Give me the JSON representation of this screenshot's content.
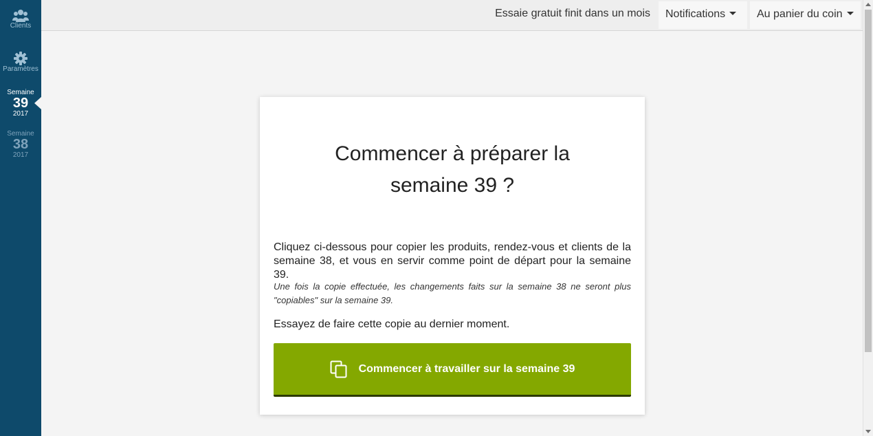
{
  "sidebar": {
    "clients": {
      "label": "Clients",
      "icon": "users-icon"
    },
    "params": {
      "label": "Paramètres",
      "icon": "gear-icon"
    },
    "weeks": [
      {
        "label": "Semaine",
        "number": "39",
        "year": "2017",
        "active": true
      },
      {
        "label": "Semaine",
        "number": "38",
        "year": "2017",
        "active": false
      }
    ]
  },
  "topbar": {
    "trial_text": "Essaie gratuit finit dans un mois",
    "notifications_label": "Notifications",
    "shop_label": "Au panier du coin"
  },
  "card": {
    "title_line1": "Commencer à préparer la",
    "title_line2": "semaine 39 ?",
    "main_text": "Cliquez ci-dessous pour copier les produits, rendez-vous et clients de la semaine 38, et vous en servir comme point de départ pour la semaine 39.",
    "note_text": "Une fois la copie effectuée, les changements faits sur la semaine 38 ne seront plus \"copiables\" sur la semaine 39.",
    "tip_text": "Essayez de faire cette copie au dernier moment.",
    "button_label": "Commencer à travailler sur la semaine 39",
    "button_icon": "copy-icon"
  },
  "colors": {
    "sidebar_bg": "#0e4a6b",
    "button_green": "#84a800",
    "page_bg": "#f4f4f4"
  }
}
